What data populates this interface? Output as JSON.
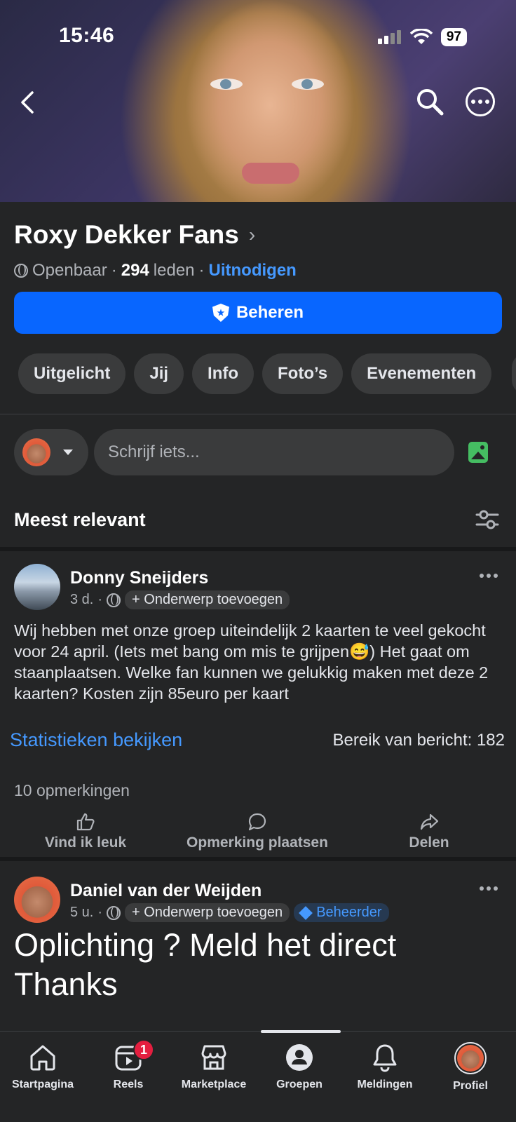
{
  "status_bar": {
    "time": "15:46",
    "battery": "97"
  },
  "group": {
    "name": "Roxy Dekker Fans",
    "privacy": "Openbaar",
    "members_count": "294",
    "members_label": "leden",
    "invite_label": "Uitnodigen",
    "manage_label": "Beheren"
  },
  "tabs": [
    "Uitgelicht",
    "Jij",
    "Info",
    "Foto’s",
    "Evenementen"
  ],
  "composer": {
    "placeholder": "Schrijf iets..."
  },
  "sort": {
    "label": "Meest relevant"
  },
  "posts": [
    {
      "author": "Donny Sneijders",
      "time": "3 d.",
      "topic_label": "+ Onderwerp toevoegen",
      "text": "Wij hebben met onze groep uiteindelijk 2 kaarten te veel gekocht voor 24 april. (Iets met bang om mis te grijpen😅) Het gaat om staanplaatsen. Welke fan kunnen we gelukkig maken met deze 2 kaarten? Kosten zijn 85euro per kaart",
      "stats_link": "Statistieken bekijken",
      "reach": "Bereik van bericht: 182",
      "comments": "10 opmerkingen",
      "actions": {
        "like": "Vind ik leuk",
        "comment": "Opmerking plaatsen",
        "share": "Delen"
      }
    },
    {
      "author": "Daniel van der Weijden",
      "time": "5 u.",
      "topic_label": "+ Onderwerp toevoegen",
      "badge": "Beheerder",
      "text_line1": "Oplichting ? Meld het direct",
      "text_line2": "Thanks"
    }
  ],
  "bottom_nav": {
    "items": [
      "Startpagina",
      "Reels",
      "Marketplace",
      "Groepen",
      "Meldingen",
      "Profiel"
    ],
    "reels_badge": "1",
    "active": "Groepen"
  },
  "colors": {
    "accent": "#0866ff",
    "link": "#4599ff",
    "background": "#242526",
    "badge": "#e41e3f"
  }
}
